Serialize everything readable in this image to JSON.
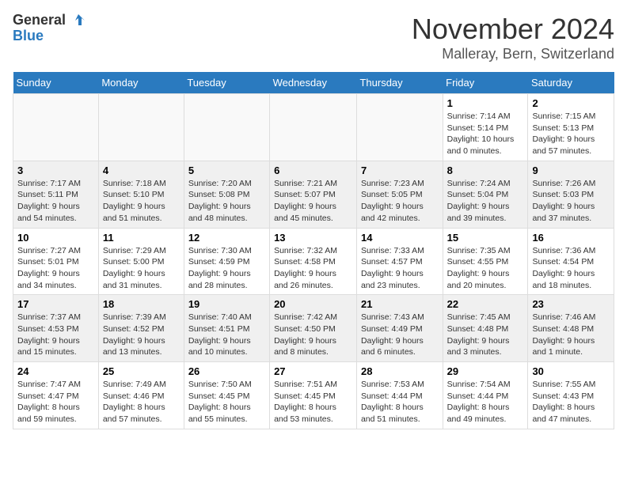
{
  "logo": {
    "line1": "General",
    "line2": "Blue"
  },
  "title": "November 2024",
  "location": "Malleray, Bern, Switzerland",
  "days_of_week": [
    "Sunday",
    "Monday",
    "Tuesday",
    "Wednesday",
    "Thursday",
    "Friday",
    "Saturday"
  ],
  "weeks": [
    [
      {
        "day": "",
        "detail": ""
      },
      {
        "day": "",
        "detail": ""
      },
      {
        "day": "",
        "detail": ""
      },
      {
        "day": "",
        "detail": ""
      },
      {
        "day": "",
        "detail": ""
      },
      {
        "day": "1",
        "detail": "Sunrise: 7:14 AM\nSunset: 5:14 PM\nDaylight: 10 hours\nand 0 minutes."
      },
      {
        "day": "2",
        "detail": "Sunrise: 7:15 AM\nSunset: 5:13 PM\nDaylight: 9 hours\nand 57 minutes."
      }
    ],
    [
      {
        "day": "3",
        "detail": "Sunrise: 7:17 AM\nSunset: 5:11 PM\nDaylight: 9 hours\nand 54 minutes."
      },
      {
        "day": "4",
        "detail": "Sunrise: 7:18 AM\nSunset: 5:10 PM\nDaylight: 9 hours\nand 51 minutes."
      },
      {
        "day": "5",
        "detail": "Sunrise: 7:20 AM\nSunset: 5:08 PM\nDaylight: 9 hours\nand 48 minutes."
      },
      {
        "day": "6",
        "detail": "Sunrise: 7:21 AM\nSunset: 5:07 PM\nDaylight: 9 hours\nand 45 minutes."
      },
      {
        "day": "7",
        "detail": "Sunrise: 7:23 AM\nSunset: 5:05 PM\nDaylight: 9 hours\nand 42 minutes."
      },
      {
        "day": "8",
        "detail": "Sunrise: 7:24 AM\nSunset: 5:04 PM\nDaylight: 9 hours\nand 39 minutes."
      },
      {
        "day": "9",
        "detail": "Sunrise: 7:26 AM\nSunset: 5:03 PM\nDaylight: 9 hours\nand 37 minutes."
      }
    ],
    [
      {
        "day": "10",
        "detail": "Sunrise: 7:27 AM\nSunset: 5:01 PM\nDaylight: 9 hours\nand 34 minutes."
      },
      {
        "day": "11",
        "detail": "Sunrise: 7:29 AM\nSunset: 5:00 PM\nDaylight: 9 hours\nand 31 minutes."
      },
      {
        "day": "12",
        "detail": "Sunrise: 7:30 AM\nSunset: 4:59 PM\nDaylight: 9 hours\nand 28 minutes."
      },
      {
        "day": "13",
        "detail": "Sunrise: 7:32 AM\nSunset: 4:58 PM\nDaylight: 9 hours\nand 26 minutes."
      },
      {
        "day": "14",
        "detail": "Sunrise: 7:33 AM\nSunset: 4:57 PM\nDaylight: 9 hours\nand 23 minutes."
      },
      {
        "day": "15",
        "detail": "Sunrise: 7:35 AM\nSunset: 4:55 PM\nDaylight: 9 hours\nand 20 minutes."
      },
      {
        "day": "16",
        "detail": "Sunrise: 7:36 AM\nSunset: 4:54 PM\nDaylight: 9 hours\nand 18 minutes."
      }
    ],
    [
      {
        "day": "17",
        "detail": "Sunrise: 7:37 AM\nSunset: 4:53 PM\nDaylight: 9 hours\nand 15 minutes."
      },
      {
        "day": "18",
        "detail": "Sunrise: 7:39 AM\nSunset: 4:52 PM\nDaylight: 9 hours\nand 13 minutes."
      },
      {
        "day": "19",
        "detail": "Sunrise: 7:40 AM\nSunset: 4:51 PM\nDaylight: 9 hours\nand 10 minutes."
      },
      {
        "day": "20",
        "detail": "Sunrise: 7:42 AM\nSunset: 4:50 PM\nDaylight: 9 hours\nand 8 minutes."
      },
      {
        "day": "21",
        "detail": "Sunrise: 7:43 AM\nSunset: 4:49 PM\nDaylight: 9 hours\nand 6 minutes."
      },
      {
        "day": "22",
        "detail": "Sunrise: 7:45 AM\nSunset: 4:48 PM\nDaylight: 9 hours\nand 3 minutes."
      },
      {
        "day": "23",
        "detail": "Sunrise: 7:46 AM\nSunset: 4:48 PM\nDaylight: 9 hours\nand 1 minute."
      }
    ],
    [
      {
        "day": "24",
        "detail": "Sunrise: 7:47 AM\nSunset: 4:47 PM\nDaylight: 8 hours\nand 59 minutes."
      },
      {
        "day": "25",
        "detail": "Sunrise: 7:49 AM\nSunset: 4:46 PM\nDaylight: 8 hours\nand 57 minutes."
      },
      {
        "day": "26",
        "detail": "Sunrise: 7:50 AM\nSunset: 4:45 PM\nDaylight: 8 hours\nand 55 minutes."
      },
      {
        "day": "27",
        "detail": "Sunrise: 7:51 AM\nSunset: 4:45 PM\nDaylight: 8 hours\nand 53 minutes."
      },
      {
        "day": "28",
        "detail": "Sunrise: 7:53 AM\nSunset: 4:44 PM\nDaylight: 8 hours\nand 51 minutes."
      },
      {
        "day": "29",
        "detail": "Sunrise: 7:54 AM\nSunset: 4:44 PM\nDaylight: 8 hours\nand 49 minutes."
      },
      {
        "day": "30",
        "detail": "Sunrise: 7:55 AM\nSunset: 4:43 PM\nDaylight: 8 hours\nand 47 minutes."
      }
    ]
  ]
}
